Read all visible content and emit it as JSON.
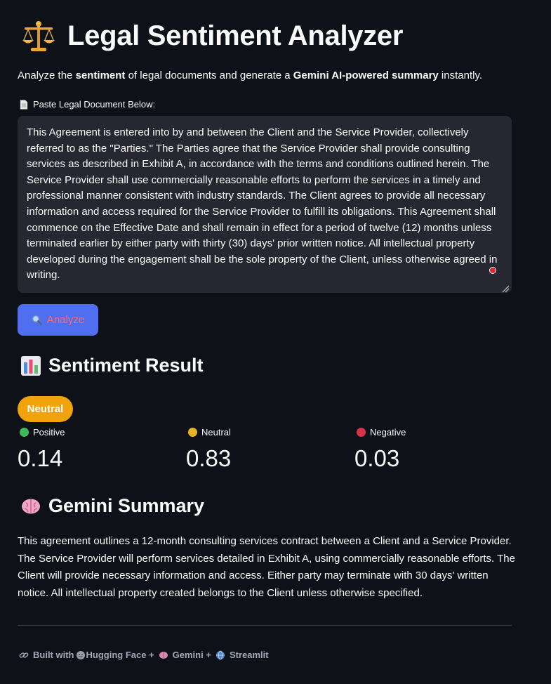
{
  "header": {
    "title": "Legal Sentiment Analyzer",
    "icon": "balance-scale-icon"
  },
  "subtitle": {
    "p1": "Analyze the ",
    "b1": "sentiment",
    "p2": " of legal documents and generate a ",
    "b2": "Gemini AI-powered summary",
    "p3": " instantly."
  },
  "input": {
    "label": "Paste Legal Document Below:",
    "value": "This Agreement is entered into by and between the Client and the Service Provider, collectively referred to as the \"Parties.\" The Parties agree that the Service Provider shall provide consulting services as described in Exhibit A, in accordance with the terms and conditions outlined herein. The Service Provider shall use commercially reasonable efforts to perform the services in a timely and professional manner consistent with industry standards. The Client agrees to provide all necessary information and access required for the Service Provider to fulfill its obligations. This Agreement shall commence on the Effective Date and shall remain in effect for a period of twelve (12) months unless terminated earlier by either party with thirty (30) days' prior written notice. All intellectual property developed during the engagement shall be the sole property of the Client, unless otherwise agreed in writing."
  },
  "analyze_button": {
    "label": "Analyze",
    "color": "#4f6ef2",
    "text_color": "#ff6b6b"
  },
  "sentiment": {
    "heading": "Sentiment Result",
    "badge": "Neutral",
    "badge_color": "#f0a30a",
    "metrics": [
      {
        "label": "Positive",
        "value": "0.14",
        "color": "#3dbb5c"
      },
      {
        "label": "Neutral",
        "value": "0.83",
        "color": "#e6b422"
      },
      {
        "label": "Negative",
        "value": "0.03",
        "color": "#d6334a"
      }
    ]
  },
  "gemini": {
    "heading": "Gemini Summary",
    "summary": "This agreement outlines a 12-month consulting services contract between a Client and a Service Provider. The Service Provider will perform services detailed in Exhibit A, using commercially reasonable efforts. The Client will provide necessary information and access. Either party may terminate with 30 days' written notice. All intellectual property created belongs to the Client unless otherwise specified."
  },
  "footer": {
    "t1": "Built with",
    "t2": "Hugging Face +",
    "t3": "Gemini +",
    "t4": "Streamlit"
  }
}
